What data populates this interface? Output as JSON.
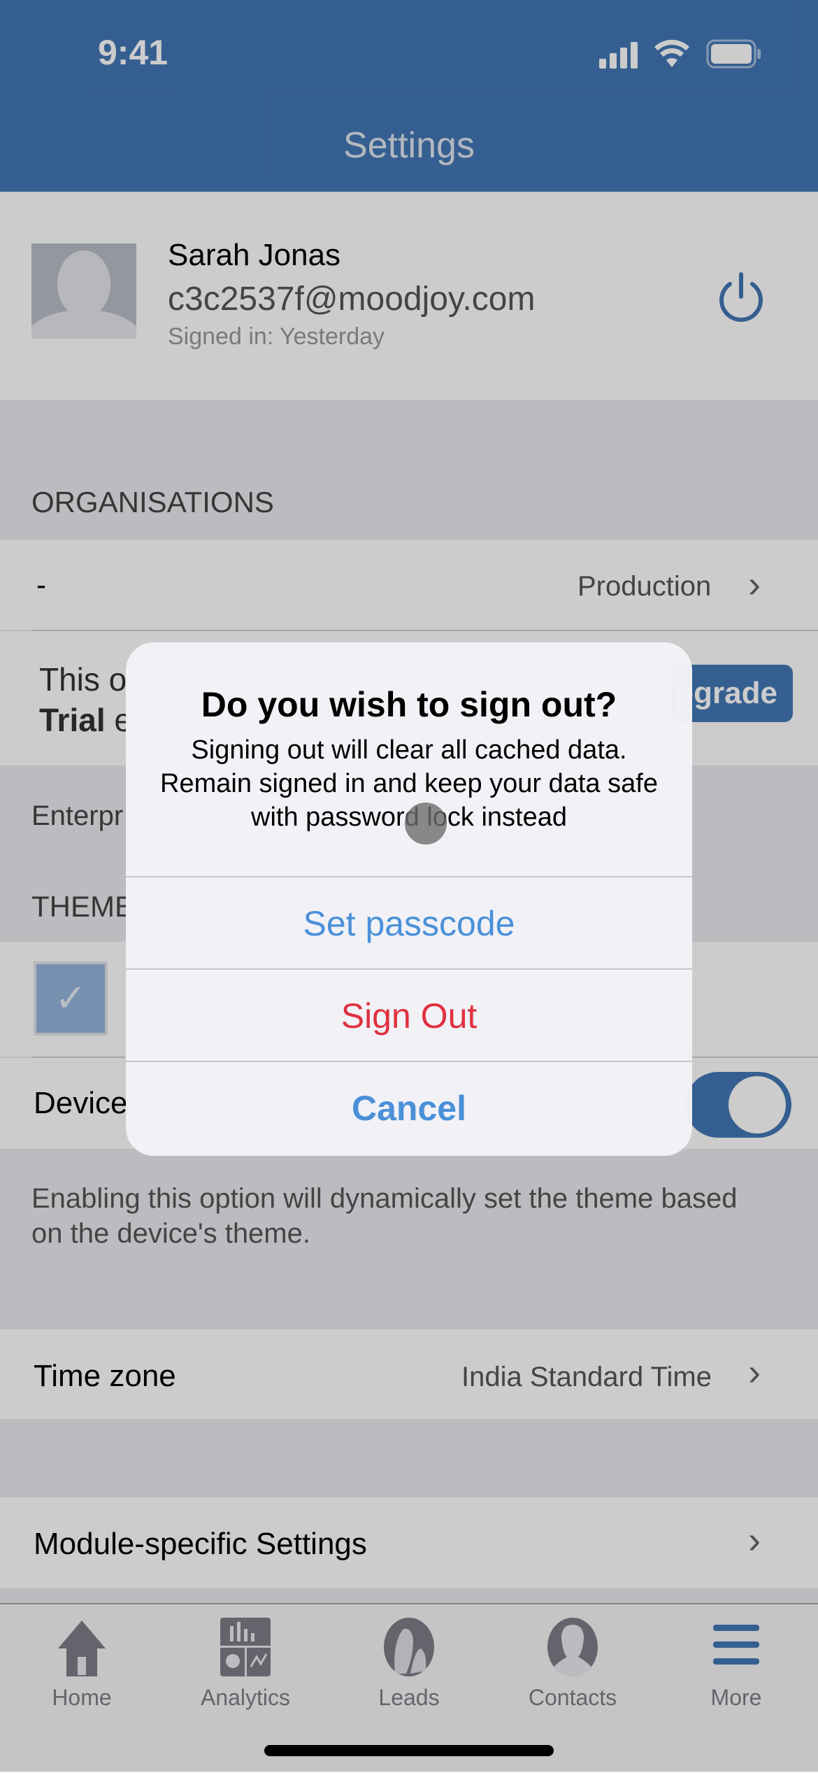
{
  "status_bar": {
    "time": "9:41"
  },
  "header": {
    "title": "Settings"
  },
  "profile": {
    "name": "Sarah Jonas",
    "email": "c3c2537f@moodjoy.com",
    "signed_in": "Signed in: Yesterday"
  },
  "organisations": {
    "section_label": "ORGANISATIONS",
    "org_name": "-",
    "org_env": "Production",
    "trial_line1": "This o",
    "trial_bold": "Trial",
    "trial_rest": " e",
    "upgrade_label": "pgrade",
    "edition": "Enterpr"
  },
  "theme": {
    "section_label": "THEME",
    "checkbox_checked": true,
    "device_label": "Device",
    "device_toggle_on": true,
    "footnote": "Enabling this option will dynamically set the theme based on the device's theme."
  },
  "timezone": {
    "label": "Time zone",
    "value": "India Standard Time"
  },
  "module_settings": {
    "label": "Module-specific Settings"
  },
  "dialog": {
    "title": "Do you wish to sign out?",
    "message": "Signing out will clear all cached data. Remain signed in and keep your data safe with password lock instead",
    "buttons": [
      {
        "label": "Set passcode",
        "color": "#4a90d9"
      },
      {
        "label": "Sign Out",
        "color": "#e0303e"
      },
      {
        "label": "Cancel",
        "color": "#4a90d9"
      }
    ]
  },
  "tabbar": {
    "items": [
      {
        "label": "Home",
        "icon": "home-icon"
      },
      {
        "label": "Analytics",
        "icon": "analytics-icon"
      },
      {
        "label": "Leads",
        "icon": "leads-icon"
      },
      {
        "label": "Contacts",
        "icon": "contacts-icon"
      },
      {
        "label": "More",
        "icon": "more-icon",
        "active": true
      }
    ]
  },
  "colors": {
    "brand": "#4377b5",
    "destructive": "#e0303e",
    "link": "#4a90d9"
  }
}
